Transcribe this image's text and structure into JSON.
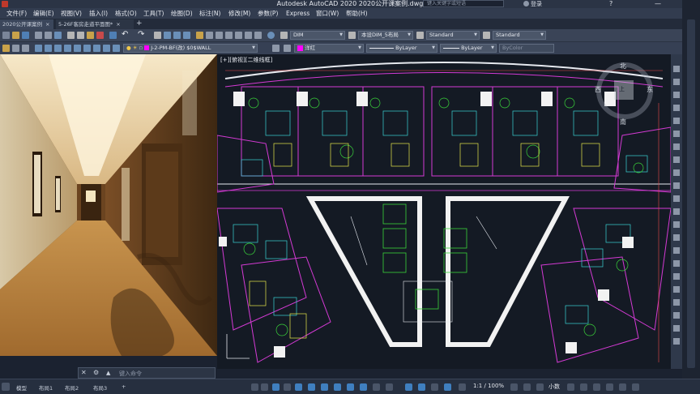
{
  "window": {
    "title": "Autodesk AutoCAD 2020    2020公开课案例.dwg",
    "search_placeholder": "键入关键字或短语",
    "login": "登录",
    "help": "?",
    "minimize": "—",
    "close": "✕"
  },
  "menu": [
    "文件(F)",
    "编辑(E)",
    "视图(V)",
    "插入(I)",
    "格式(O)",
    "工具(T)",
    "绘图(D)",
    "标注(N)",
    "修改(M)",
    "参数(P)",
    "Express",
    "窗口(W)",
    "帮助(H)"
  ],
  "tabs": {
    "doc1": "2020公开课案例",
    "doc2": "5-26F客房走道平面图*"
  },
  "toolbar": {
    "dimstyle": "DIM",
    "textstyle": "本设DIM_5布局",
    "tablestyle": "Standard",
    "mleaderstyle": "Standard",
    "layer": "J-2-PM-BF(改)  $0$WALL",
    "color": "洋红",
    "linetype": "ByLayer",
    "lineweight": "ByLayer",
    "plotstyle": "ByColor"
  },
  "viewport": {
    "label": "[+][俯视][二维线框]",
    "compass": {
      "north": "北",
      "east": "东",
      "south": "南",
      "west": "西",
      "top": "上"
    }
  },
  "command": {
    "placeholder": "键入命令"
  },
  "status": {
    "tabs": [
      "模型",
      "布局1",
      "布局2",
      "布局3"
    ],
    "scale": "1:1 / 100%",
    "units": "小数"
  },
  "colors": {
    "background": "#1b2230",
    "drawing_bg": "#141a24",
    "accent": "#3f7fbf"
  }
}
